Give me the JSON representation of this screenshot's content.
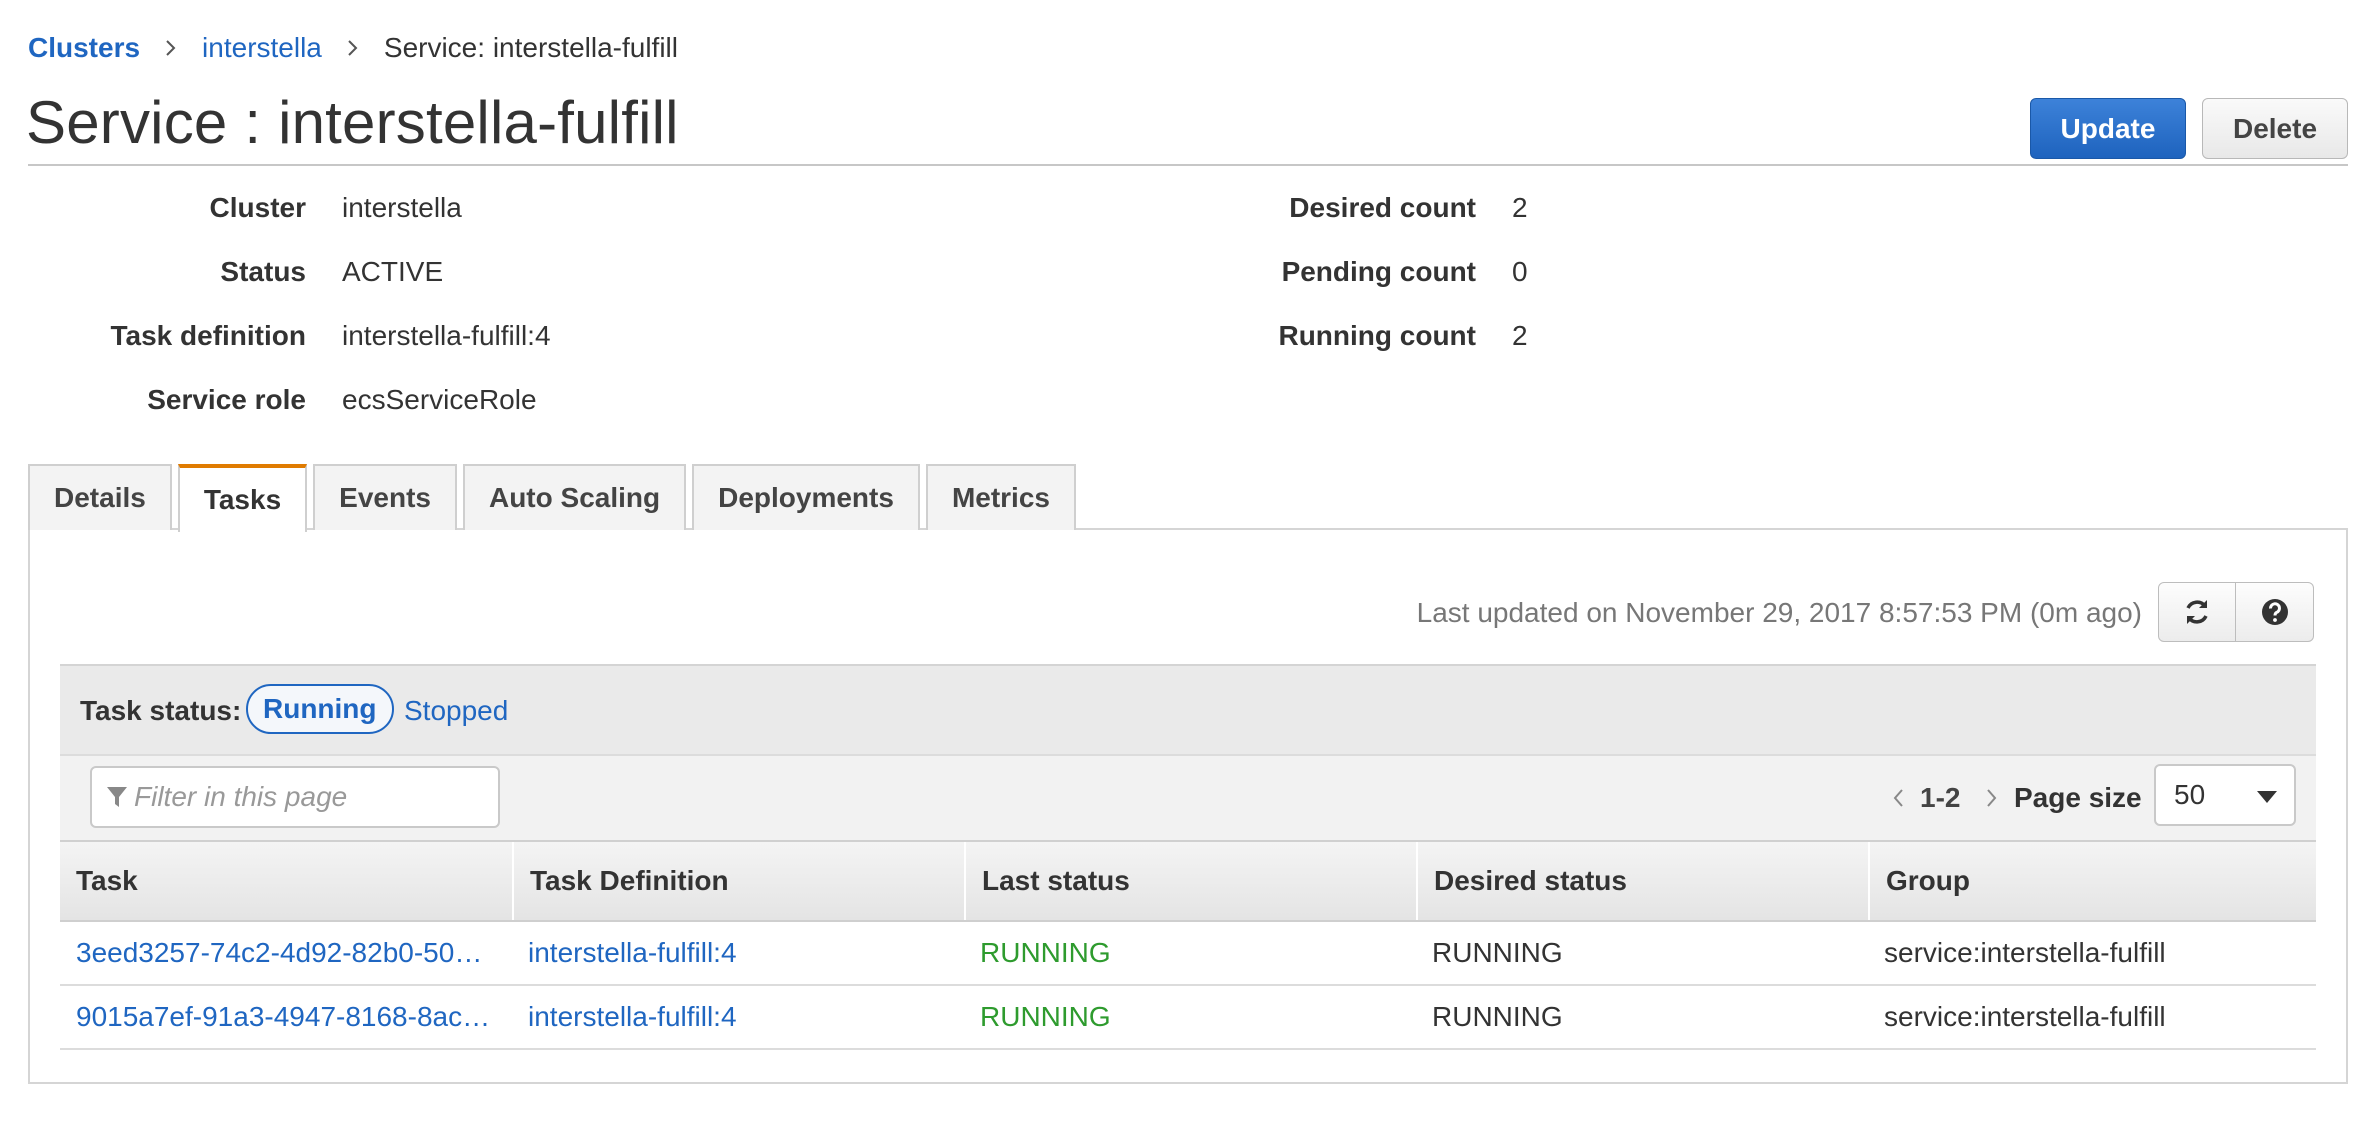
{
  "breadcrumb": {
    "root": "Clusters",
    "cluster": "interstella",
    "current": "Service: interstella-fulfill"
  },
  "header": {
    "title": "Service : interstella-fulfill",
    "update_label": "Update",
    "delete_label": "Delete"
  },
  "summary": {
    "left": [
      {
        "label": "Cluster",
        "value": "interstella"
      },
      {
        "label": "Status",
        "value": "ACTIVE"
      },
      {
        "label": "Task definition",
        "value": "interstella-fulfill:4"
      },
      {
        "label": "Service role",
        "value": "ecsServiceRole"
      }
    ],
    "right": [
      {
        "label": "Desired count",
        "value": "2"
      },
      {
        "label": "Pending count",
        "value": "0"
      },
      {
        "label": "Running count",
        "value": "2"
      }
    ]
  },
  "tabs": [
    {
      "label": "Details"
    },
    {
      "label": "Tasks"
    },
    {
      "label": "Events"
    },
    {
      "label": "Auto Scaling"
    },
    {
      "label": "Deployments"
    },
    {
      "label": "Metrics"
    }
  ],
  "active_tab": "Tasks",
  "tasks_panel": {
    "last_updated": "Last updated on November 29, 2017 8:57:53 PM (0m ago)",
    "task_status_label": "Task status:",
    "status_running": "Running",
    "status_stopped": "Stopped",
    "filter_placeholder": "Filter in this page",
    "pager_range": "1-2",
    "page_size_label": "Page size",
    "page_size_value": "50",
    "columns": [
      "Task",
      "Task Definition",
      "Last status",
      "Desired status",
      "Group"
    ],
    "rows": [
      {
        "task": "3eed3257-74c2-4d92-82b0-50…",
        "task_definition": "interstella-fulfill:4",
        "last_status": "RUNNING",
        "desired_status": "RUNNING",
        "group": "service:interstella-fulfill"
      },
      {
        "task": "9015a7ef-91a3-4947-8168-8ac…",
        "task_definition": "interstella-fulfill:4",
        "last_status": "RUNNING",
        "desired_status": "RUNNING",
        "group": "service:interstella-fulfill"
      }
    ]
  },
  "colors": {
    "link": "#1f66c1",
    "status_green": "#2e9b2e",
    "primary_button": "#1e63be",
    "active_tab_accent": "#e07b00"
  },
  "icons": {
    "separator": "chevron-right-icon",
    "refresh": "refresh-icon",
    "help": "help-icon",
    "filter": "filter-icon",
    "pager_prev": "chevron-left-icon",
    "pager_next": "chevron-right-icon",
    "dropdown": "caret-down-icon"
  }
}
